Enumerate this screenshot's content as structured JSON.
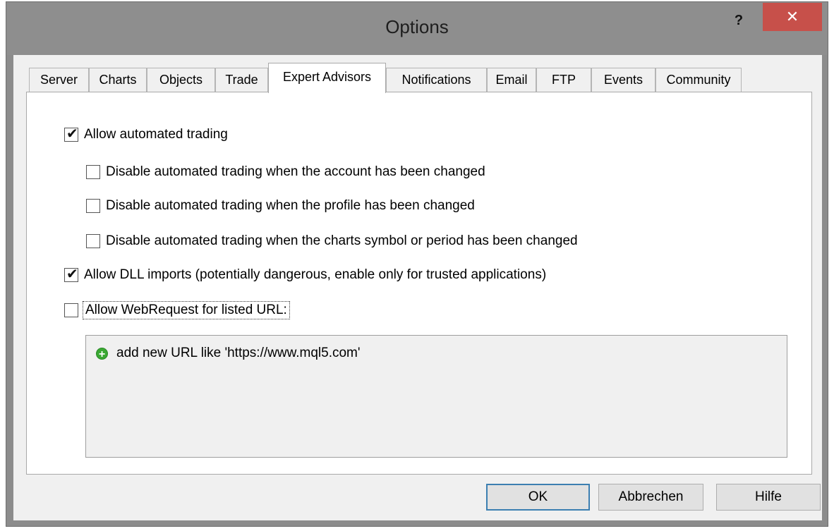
{
  "window": {
    "title": "Options",
    "help_label": "?",
    "close_label": "✕"
  },
  "tabs": [
    {
      "label": "Server",
      "active": false
    },
    {
      "label": "Charts",
      "active": false
    },
    {
      "label": "Objects",
      "active": false
    },
    {
      "label": "Trade",
      "active": false
    },
    {
      "label": "Expert Advisors",
      "active": true
    },
    {
      "label": "Notifications",
      "active": false
    },
    {
      "label": "Email",
      "active": false
    },
    {
      "label": "FTP",
      "active": false
    },
    {
      "label": "Events",
      "active": false
    },
    {
      "label": "Community",
      "active": false
    }
  ],
  "options": {
    "allow_automated": {
      "label": "Allow automated trading",
      "checked": true
    },
    "disable_account": {
      "label": "Disable automated trading when the account has been changed",
      "checked": false
    },
    "disable_profile": {
      "label": "Disable automated trading when the profile has been changed",
      "checked": false
    },
    "disable_symbol": {
      "label": "Disable automated trading when the charts symbol or period has been changed",
      "checked": false
    },
    "allow_dll": {
      "label": "Allow DLL imports (potentially dangerous, enable only for trusted applications)",
      "checked": true
    },
    "allow_webrequest": {
      "label": "Allow WebRequest for listed URL:",
      "checked": false
    }
  },
  "url_list": {
    "add_item": "add new URL like 'https://www.mql5.com'",
    "add_icon": "plus-circle-icon"
  },
  "buttons": {
    "ok": "OK",
    "cancel": "Abbrechen",
    "help": "Hilfe"
  },
  "colors": {
    "close_button": "#c7504a",
    "default_button_border": "#3c7fb1",
    "add_icon": "#3aa833"
  }
}
